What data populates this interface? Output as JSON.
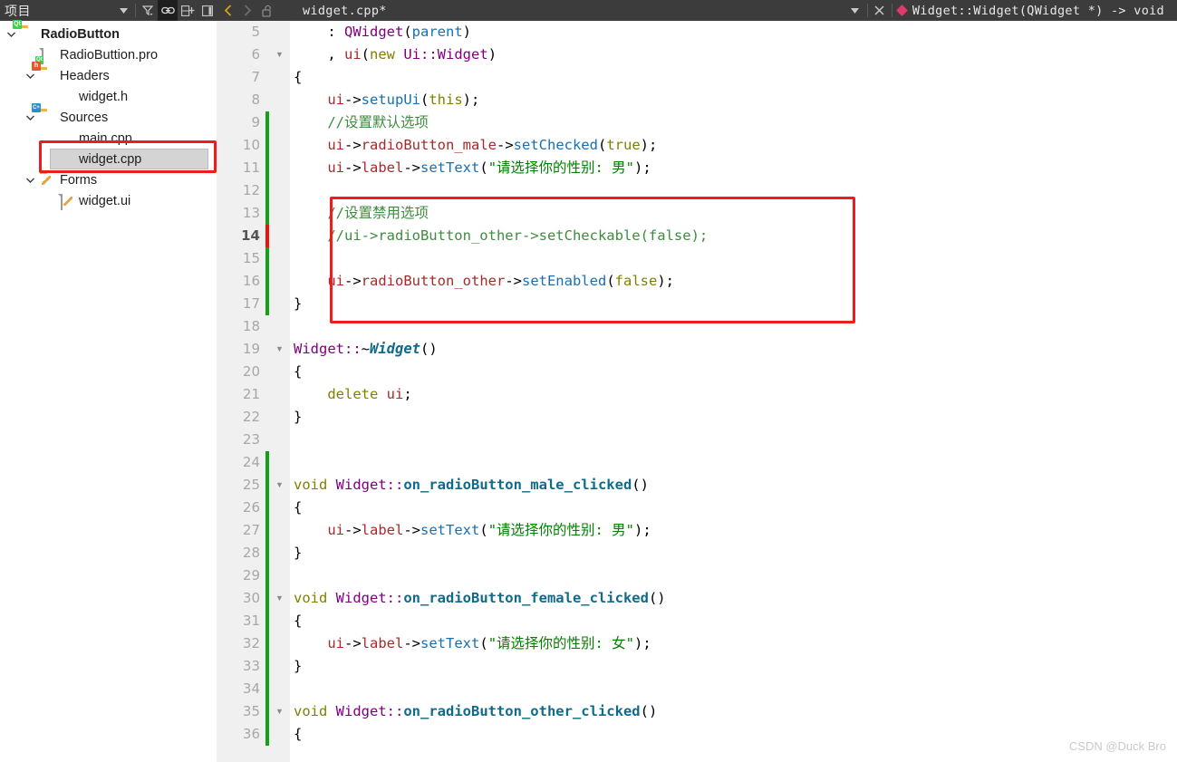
{
  "topbar": {
    "panel_title": "项目",
    "panel_dropdown_icon": "chevron-down-icon",
    "filter_icon": "filter-icon",
    "link_icon": "link-icon",
    "split_icon": "add-pane-icon",
    "collapse_icon": "collapse-panel-icon",
    "back_icon": "back-arrow-icon",
    "forward_icon": "forward-arrow-icon",
    "lock_icon": "unlocked-padlock-icon",
    "tab_name": "widget.cpp*",
    "tab_dropdown_icon": "chevron-down-icon",
    "tab_close_icon": "close-icon",
    "symbol_icon": "function-diamond-icon",
    "symbol_name": "Widget::Widget(QWidget *) -> void"
  },
  "sidebar": {
    "items": [
      {
        "label": "RadioButton",
        "indent": 0,
        "chevron": "chevron-down-icon",
        "icon": "qt-project-folder-icon",
        "bold": true,
        "selected": false
      },
      {
        "label": "RadioButtion.pro",
        "indent": 1,
        "chevron": "",
        "icon": "qt-pro-file-icon",
        "bold": false,
        "selected": false
      },
      {
        "label": "Headers",
        "indent": 1,
        "chevron": "chevron-down-icon",
        "icon": "headers-folder-icon",
        "bold": false,
        "selected": false
      },
      {
        "label": "widget.h",
        "indent": 2,
        "chevron": "",
        "icon": "",
        "bold": false,
        "selected": false
      },
      {
        "label": "Sources",
        "indent": 1,
        "chevron": "chevron-down-icon",
        "icon": "sources-folder-icon",
        "bold": false,
        "selected": false
      },
      {
        "label": "main.cpp",
        "indent": 2,
        "chevron": "",
        "icon": "",
        "bold": false,
        "selected": false
      },
      {
        "label": "widget.cpp",
        "indent": 2,
        "chevron": "",
        "icon": "",
        "bold": false,
        "selected": true
      },
      {
        "label": "Forms",
        "indent": 1,
        "chevron": "chevron-down-icon",
        "icon": "forms-folder-icon",
        "bold": false,
        "selected": false
      },
      {
        "label": "widget.ui",
        "indent": 2,
        "chevron": "",
        "icon": "ui-file-icon",
        "bold": false,
        "selected": false
      }
    ]
  },
  "editor": {
    "first_visible_line": 5,
    "current_line": 14,
    "lines": [
      {
        "n": 5,
        "fold": "",
        "change": "",
        "tokens": [
          {
            "t": "    ",
            "c": "pln"
          },
          {
            "t": ": ",
            "c": "pln"
          },
          {
            "t": "QWidget",
            "c": "type"
          },
          {
            "t": "(",
            "c": "pln"
          },
          {
            "t": "parent",
            "c": "par"
          },
          {
            "t": ")",
            "c": "pln"
          }
        ]
      },
      {
        "n": 6,
        "fold": "▼",
        "change": "",
        "tokens": [
          {
            "t": "    ",
            "c": "pln"
          },
          {
            "t": ", ",
            "c": "pln"
          },
          {
            "t": "ui",
            "c": "var"
          },
          {
            "t": "(",
            "c": "pln"
          },
          {
            "t": "new",
            "c": "kw"
          },
          {
            "t": " ",
            "c": "pln"
          },
          {
            "t": "Ui::Widget",
            "c": "type"
          },
          {
            "t": ")",
            "c": "pln"
          }
        ]
      },
      {
        "n": 7,
        "fold": "",
        "change": "",
        "tokens": [
          {
            "t": "{",
            "c": "pln"
          }
        ]
      },
      {
        "n": 8,
        "fold": "",
        "change": "",
        "tokens": [
          {
            "t": "    ",
            "c": "pln"
          },
          {
            "t": "ui",
            "c": "var"
          },
          {
            "t": "->",
            "c": "pln"
          },
          {
            "t": "setupUi",
            "c": "fn"
          },
          {
            "t": "(",
            "c": "pln"
          },
          {
            "t": "this",
            "c": "kw"
          },
          {
            "t": ");",
            "c": "pln"
          }
        ]
      },
      {
        "n": 9,
        "fold": "",
        "change": "green",
        "tokens": [
          {
            "t": "    ",
            "c": "pln"
          },
          {
            "t": "//设置默认选项",
            "c": "cmt"
          }
        ]
      },
      {
        "n": 10,
        "fold": "",
        "change": "green",
        "tokens": [
          {
            "t": "    ",
            "c": "pln"
          },
          {
            "t": "ui",
            "c": "var"
          },
          {
            "t": "->",
            "c": "pln"
          },
          {
            "t": "radioButton_male",
            "c": "var"
          },
          {
            "t": "->",
            "c": "pln"
          },
          {
            "t": "setChecked",
            "c": "fn"
          },
          {
            "t": "(",
            "c": "pln"
          },
          {
            "t": "true",
            "c": "kw"
          },
          {
            "t": ");",
            "c": "pln"
          }
        ]
      },
      {
        "n": 11,
        "fold": "",
        "change": "green",
        "tokens": [
          {
            "t": "    ",
            "c": "pln"
          },
          {
            "t": "ui",
            "c": "var"
          },
          {
            "t": "->",
            "c": "pln"
          },
          {
            "t": "label",
            "c": "var"
          },
          {
            "t": "->",
            "c": "pln"
          },
          {
            "t": "setText",
            "c": "fn"
          },
          {
            "t": "(",
            "c": "pln"
          },
          {
            "t": "\"请选择你的性别: 男\"",
            "c": "str"
          },
          {
            "t": ");",
            "c": "pln"
          }
        ]
      },
      {
        "n": 12,
        "fold": "",
        "change": "green",
        "tokens": []
      },
      {
        "n": 13,
        "fold": "",
        "change": "green",
        "tokens": [
          {
            "t": "    ",
            "c": "pln"
          },
          {
            "t": "//设置禁用选项",
            "c": "cmt"
          }
        ]
      },
      {
        "n": 14,
        "fold": "",
        "change": "red",
        "tokens": [
          {
            "t": "    ",
            "c": "pln"
          },
          {
            "t": "//ui->radioButton_other->setCheckable(false);",
            "c": "cmt"
          }
        ]
      },
      {
        "n": 15,
        "fold": "",
        "change": "green",
        "tokens": []
      },
      {
        "n": 16,
        "fold": "",
        "change": "green",
        "tokens": [
          {
            "t": "    ",
            "c": "pln"
          },
          {
            "t": "ui",
            "c": "var"
          },
          {
            "t": "->",
            "c": "pln"
          },
          {
            "t": "radioButton_other",
            "c": "var"
          },
          {
            "t": "->",
            "c": "pln"
          },
          {
            "t": "setEnabled",
            "c": "fn"
          },
          {
            "t": "(",
            "c": "pln"
          },
          {
            "t": "false",
            "c": "kw"
          },
          {
            "t": ");",
            "c": "pln"
          }
        ]
      },
      {
        "n": 17,
        "fold": "",
        "change": "green",
        "tokens": [
          {
            "t": "}",
            "c": "pln"
          }
        ]
      },
      {
        "n": 18,
        "fold": "",
        "change": "",
        "tokens": []
      },
      {
        "n": 19,
        "fold": "▼",
        "change": "",
        "tokens": [
          {
            "t": "Widget::",
            "c": "type"
          },
          {
            "t": "~",
            "c": "pln"
          },
          {
            "t": "Widget",
            "c": "dtor"
          },
          {
            "t": "()",
            "c": "pln"
          }
        ]
      },
      {
        "n": 20,
        "fold": "",
        "change": "",
        "tokens": [
          {
            "t": "{",
            "c": "pln"
          }
        ]
      },
      {
        "n": 21,
        "fold": "",
        "change": "",
        "tokens": [
          {
            "t": "    ",
            "c": "pln"
          },
          {
            "t": "delete",
            "c": "kw"
          },
          {
            "t": " ",
            "c": "pln"
          },
          {
            "t": "ui",
            "c": "var"
          },
          {
            "t": ";",
            "c": "pln"
          }
        ]
      },
      {
        "n": 22,
        "fold": "",
        "change": "",
        "tokens": [
          {
            "t": "}",
            "c": "pln"
          }
        ]
      },
      {
        "n": 23,
        "fold": "",
        "change": "",
        "tokens": []
      },
      {
        "n": 24,
        "fold": "",
        "change": "green",
        "tokens": []
      },
      {
        "n": 25,
        "fold": "▼",
        "change": "green",
        "tokens": [
          {
            "t": "void",
            "c": "kw"
          },
          {
            "t": " ",
            "c": "pln"
          },
          {
            "t": "Widget::",
            "c": "type"
          },
          {
            "t": "on_radioButton_male_clicked",
            "c": "fndef"
          },
          {
            "t": "()",
            "c": "pln"
          }
        ]
      },
      {
        "n": 26,
        "fold": "",
        "change": "green",
        "tokens": [
          {
            "t": "{",
            "c": "pln"
          }
        ]
      },
      {
        "n": 27,
        "fold": "",
        "change": "green",
        "tokens": [
          {
            "t": "    ",
            "c": "pln"
          },
          {
            "t": "ui",
            "c": "var"
          },
          {
            "t": "->",
            "c": "pln"
          },
          {
            "t": "label",
            "c": "var"
          },
          {
            "t": "->",
            "c": "pln"
          },
          {
            "t": "setText",
            "c": "fn"
          },
          {
            "t": "(",
            "c": "pln"
          },
          {
            "t": "\"请选择你的性别: 男\"",
            "c": "str"
          },
          {
            "t": ");",
            "c": "pln"
          }
        ]
      },
      {
        "n": 28,
        "fold": "",
        "change": "green",
        "tokens": [
          {
            "t": "}",
            "c": "pln"
          }
        ]
      },
      {
        "n": 29,
        "fold": "",
        "change": "green",
        "tokens": []
      },
      {
        "n": 30,
        "fold": "▼",
        "change": "green",
        "tokens": [
          {
            "t": "void",
            "c": "kw"
          },
          {
            "t": " ",
            "c": "pln"
          },
          {
            "t": "Widget::",
            "c": "type"
          },
          {
            "t": "on_radioButton_female_clicked",
            "c": "fndef"
          },
          {
            "t": "()",
            "c": "pln"
          }
        ]
      },
      {
        "n": 31,
        "fold": "",
        "change": "green",
        "tokens": [
          {
            "t": "{",
            "c": "pln"
          }
        ]
      },
      {
        "n": 32,
        "fold": "",
        "change": "green",
        "tokens": [
          {
            "t": "    ",
            "c": "pln"
          },
          {
            "t": "ui",
            "c": "var"
          },
          {
            "t": "->",
            "c": "pln"
          },
          {
            "t": "label",
            "c": "var"
          },
          {
            "t": "->",
            "c": "pln"
          },
          {
            "t": "setText",
            "c": "fn"
          },
          {
            "t": "(",
            "c": "pln"
          },
          {
            "t": "\"请选择你的性别: 女\"",
            "c": "str"
          },
          {
            "t": ");",
            "c": "pln"
          }
        ]
      },
      {
        "n": 33,
        "fold": "",
        "change": "green",
        "tokens": [
          {
            "t": "}",
            "c": "pln"
          }
        ]
      },
      {
        "n": 34,
        "fold": "",
        "change": "green",
        "tokens": []
      },
      {
        "n": 35,
        "fold": "▼",
        "change": "green",
        "tokens": [
          {
            "t": "void",
            "c": "kw"
          },
          {
            "t": " ",
            "c": "pln"
          },
          {
            "t": "Widget::",
            "c": "type"
          },
          {
            "t": "on_radioButton_other_clicked",
            "c": "fndef"
          },
          {
            "t": "()",
            "c": "pln"
          }
        ]
      },
      {
        "n": 36,
        "fold": "",
        "change": "green",
        "tokens": [
          {
            "t": "{",
            "c": "pln"
          }
        ]
      }
    ]
  },
  "annotations": [
    {
      "name": "sidebar-highlight-box",
      "color": "#ee1c1c"
    },
    {
      "name": "code-highlight-box",
      "color": "#ee1c1c"
    }
  ],
  "watermark": {
    "text": "CSDN @Duck Bro"
  }
}
